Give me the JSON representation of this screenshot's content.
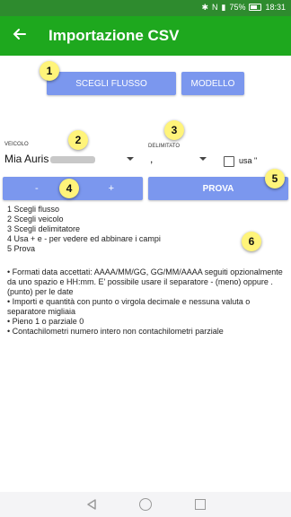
{
  "status": {
    "battery_percent": "75%",
    "time": "18:31"
  },
  "appbar": {
    "title": "Importazione CSV"
  },
  "buttons": {
    "scegli_flusso": "SCEGLI FLUSSO",
    "modello": "MODELLO",
    "minus": "-",
    "plus": "+",
    "prova": "PROVA"
  },
  "veicolo": {
    "label": "VEICOLO",
    "value": "Mia Auris"
  },
  "delimitatore": {
    "label": "DELIMITATO",
    "value": ","
  },
  "checkbox": {
    "label": "usa \""
  },
  "badges": [
    "1",
    "2",
    "3",
    "4",
    "5",
    "6"
  ],
  "steps": [
    "1 Scegli flusso",
    "2 Scegli veicolo",
    "3 Scegli delimitatore",
    "4 Usa + e - per vedere ed abbinare i campi",
    "5 Prova"
  ],
  "notes": [
    "• Formati data accettati: AAAA/MM/GG, GG/MM/AAAA seguiti opzionalmente da uno spazio e HH:mm. E' possibile usare il separatore - (meno) oppure . (punto) per le date",
    "• Importi e quantità con punto o virgola decimale e nessuna valuta o separatore migliaia",
    "• Pieno 1 o parziale 0",
    "• Contachilometri numero intero non contachilometri parziale"
  ],
  "colors": {
    "appbar": "#1ea81e",
    "statusbar": "#2e8b2e",
    "button": "#7b97ee",
    "badge": "#fff47a"
  }
}
